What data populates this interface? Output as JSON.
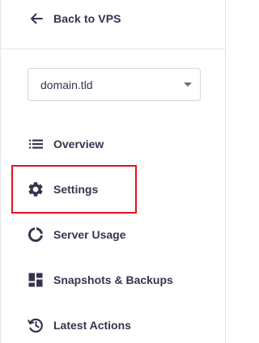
{
  "back_link": {
    "label": "Back to VPS",
    "icon": "arrow-left-icon"
  },
  "domain_select": {
    "value": "domain.tld",
    "icon": "chevron-down-icon"
  },
  "nav": {
    "items": [
      {
        "label": "Overview",
        "icon": "list-icon"
      },
      {
        "label": "Settings",
        "icon": "gear-icon"
      },
      {
        "label": "Server Usage",
        "icon": "donut-chart-icon"
      },
      {
        "label": "Snapshots & Backups",
        "icon": "grid-tiles-icon"
      },
      {
        "label": "Latest Actions",
        "icon": "history-clock-icon"
      }
    ],
    "highlighted": "Settings"
  },
  "colors": {
    "text": "#36344d",
    "icon": "#36344d",
    "highlight": "#e2121d",
    "border": "#d4d4de"
  }
}
